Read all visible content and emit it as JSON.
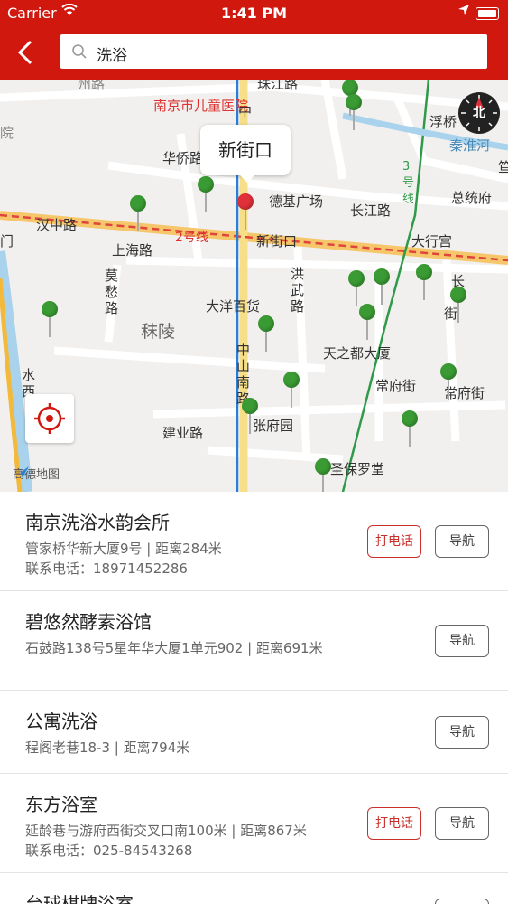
{
  "status_bar": {
    "carrier": "Carrier",
    "time": "1:41 PM"
  },
  "search": {
    "query": "洗浴"
  },
  "map": {
    "callout": "新街口",
    "compass": "北",
    "watermark": "高德地图",
    "labels": {
      "children_hospital": "南京市儿童医院",
      "zhujiang_rd": "珠江路",
      "huaqiao_rd": "华侨路",
      "deji_plaza": "德基广场",
      "changjiang_rd": "长江路",
      "hanzhong_rd": "汉中路",
      "line2": "2号线",
      "xinjiekou_station": "新街口",
      "daxinggong": "大行宫",
      "shanghai_rd": "上海路",
      "moling": "秣陵",
      "dayang": "大洋百货",
      "hongwu_rd": "洪武路",
      "mochou_rd": "莫愁路",
      "tianzhidu": "天之都大厦",
      "changfu_st": "常府街",
      "changfu_st2": "常府街",
      "zhongshan_s_rd": "中山南路",
      "zhangfu_park": "张府园",
      "jianye_rd": "建业路",
      "st_paul": "圣保罗堂",
      "zongtongfu": "总统府",
      "qinhuai": "秦淮河",
      "line3": "3号线",
      "fuqiao": "浮桥",
      "zhong": "中",
      "yuan": "院",
      "chuan": "州路",
      "men": "门",
      "shui": "水西",
      "chang": "长",
      "jie": "街",
      "xia": "汉",
      "k": "笪"
    }
  },
  "results": [
    {
      "name": "南京洗浴水韵会所",
      "address": "管家桥华新大厦9号 | 距离284米",
      "phone": "联系电话：18971452286",
      "call_label": "打电话",
      "nav_label": "导航"
    },
    {
      "name": "碧悠然酵素浴馆",
      "address": "石鼓路138号5星年华大厦1单元902 | 距离691米",
      "nav_label": "导航"
    },
    {
      "name": "公寓洗浴",
      "address": "程阁老巷18-3 | 距离794米",
      "nav_label": "导航"
    },
    {
      "name": "东方浴室",
      "address": "延龄巷与游府西街交叉口南100米 | 距离867米",
      "phone": "联系电话：025-84543268",
      "call_label": "打电话",
      "nav_label": "导航"
    },
    {
      "name": "台球棋牌浴室",
      "nav_label": "导航"
    }
  ]
}
